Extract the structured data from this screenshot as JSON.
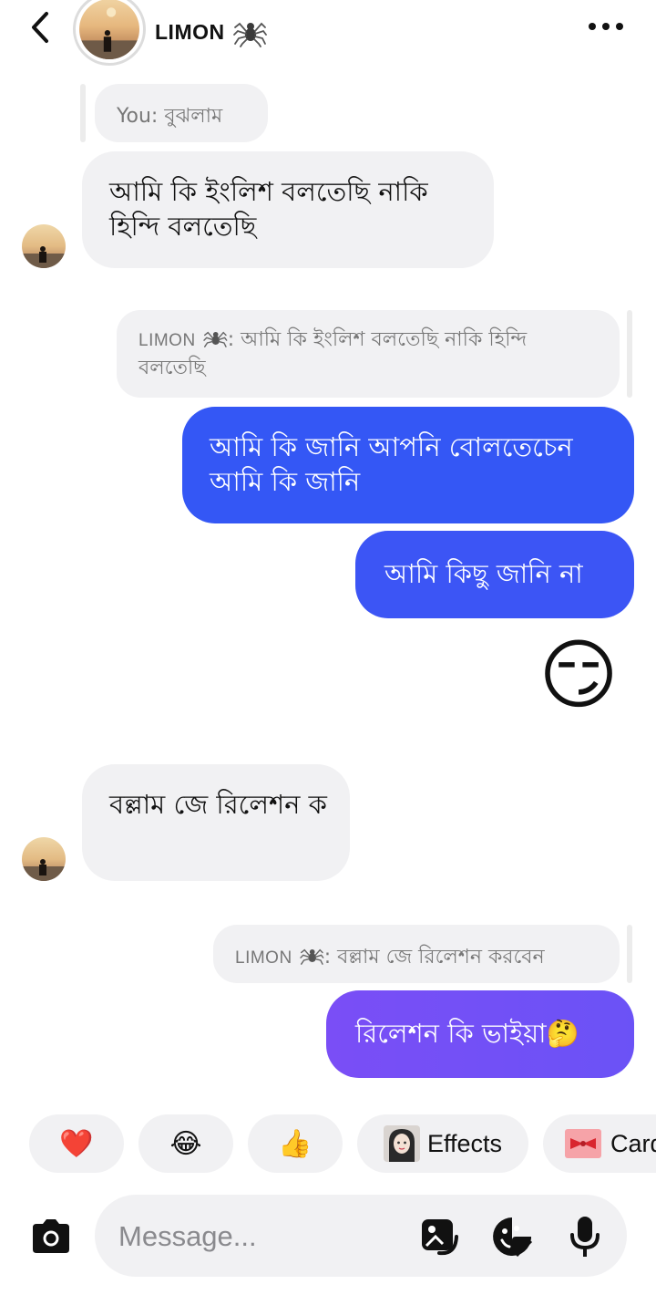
{
  "header": {
    "contact_name": "LIMON",
    "name_emoji_icon": "spider-icon"
  },
  "messages": [
    {
      "type": "reply-preview",
      "text": "You: বুঝলাম"
    },
    {
      "type": "incoming",
      "text": "আমি কি ইংলিশ বলতেছি নাকি হিন্দি বলতেছি"
    },
    {
      "type": "reply-preview",
      "name": "LIMON",
      "text": ": আমি কি ইংলিশ বলতেছি নাকি হিন্দি বলতেছি"
    },
    {
      "type": "outgoing",
      "text": "আমি কি জানি আপনি বোলতেচেন আমি কি জানি"
    },
    {
      "type": "outgoing",
      "text": "আমি কিছু জানি না"
    },
    {
      "type": "emoji",
      "text": "😏"
    },
    {
      "type": "incoming",
      "text": "বল্লাম জে রিলেশন ক"
    },
    {
      "type": "reply-preview",
      "name": "LIMON",
      "text": ": বল্লাম জে রিলেশন করবেন"
    },
    {
      "type": "outgoing",
      "text": "রিলেশন কি ভাইয়া🤔"
    }
  ],
  "quick_reactions": [
    {
      "emoji": "❤️"
    },
    {
      "emoji": "😂"
    },
    {
      "emoji": "👍"
    },
    {
      "label": "Effects",
      "icon": "effects-avatar-icon"
    },
    {
      "label": "Card",
      "icon": "ribbon-card-icon"
    }
  ],
  "composer": {
    "placeholder": "Message..."
  },
  "colors": {
    "outgoing_blue": "#3457f5",
    "outgoing_purple": "#7450f6",
    "incoming_bg": "#f1f1f3"
  }
}
